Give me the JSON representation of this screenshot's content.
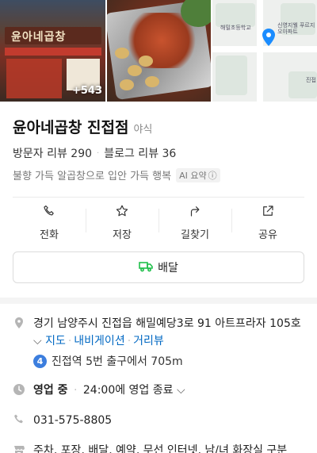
{
  "photos": {
    "more_count": "+543",
    "store_sign": "윤아네곱창",
    "map_labels": [
      "해밀초등학교",
      "신영지웰 푸르지오아파트",
      "진접"
    ]
  },
  "place": {
    "name": "윤아네곱창 진접점",
    "category": "야식",
    "visitor_reviews": "방문자 리뷰 290",
    "blog_reviews": "블로그 리뷰 36",
    "summary": "불향 가득 알곱창으로 입안 가득 행복",
    "ai_badge": "AI 요약",
    "ai_info_glyph": "ⓘ"
  },
  "actions": [
    {
      "label": "전화",
      "icon": "phone-icon"
    },
    {
      "label": "저장",
      "icon": "star-icon"
    },
    {
      "label": "길찾기",
      "icon": "directions-icon"
    },
    {
      "label": "공유",
      "icon": "share-icon"
    }
  ],
  "delivery": {
    "label": "배달",
    "icon": "delivery-truck-icon"
  },
  "info": {
    "address": "경기 남양주시 진접읍 해밀예당3로 91 아트프라자 105호",
    "address_chevron": "⌵",
    "links": [
      "지도",
      "내비게이션",
      "거리뷰"
    ],
    "subway_line": "4",
    "subway": "진접역 5번 출구에서 705m",
    "status": "영업 중",
    "hours": "24:00에 영업 종료",
    "phone": "031-575-8805",
    "amenities": "주차, 포장, 배달, 예약, 무선 인터넷, 남/녀 화장실 구분"
  },
  "colors": {
    "link": "#0068c3",
    "delivery_icon": "#1fbf4a",
    "subway_line4": "#3c7ede"
  }
}
